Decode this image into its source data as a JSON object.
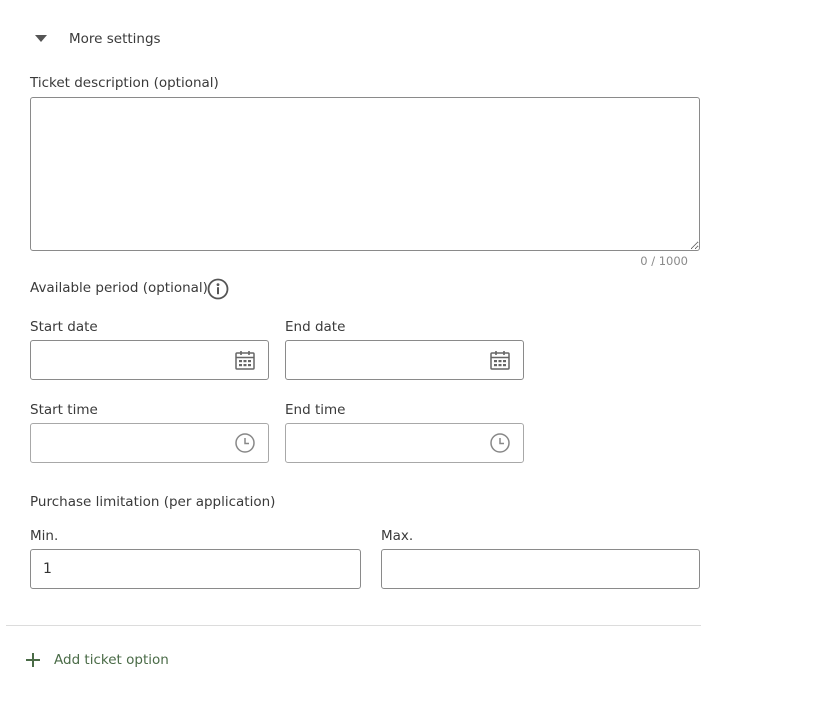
{
  "more_settings": {
    "label": "More settings",
    "icon": "caret-down-icon"
  },
  "description": {
    "label": "Ticket description (optional)",
    "value": "",
    "counter": "0 / 1000"
  },
  "period": {
    "label": "Available period (optional)",
    "info_icon": "info-icon",
    "start_date": {
      "label": "Start date",
      "value": "",
      "icon": "calendar-icon"
    },
    "end_date": {
      "label": "End date",
      "value": "",
      "icon": "calendar-icon"
    },
    "start_time": {
      "label": "Start time",
      "value": "",
      "icon": "clock-icon"
    },
    "end_time": {
      "label": "End time",
      "value": "",
      "icon": "clock-icon"
    }
  },
  "limitation": {
    "label": "Purchase limitation (per application)",
    "min": {
      "label": "Min.",
      "value": "1"
    },
    "max": {
      "label": "Max.",
      "value": ""
    }
  },
  "add_option": {
    "label": "Add ticket option",
    "icon": "plus-icon",
    "color": "#4a6b47"
  }
}
